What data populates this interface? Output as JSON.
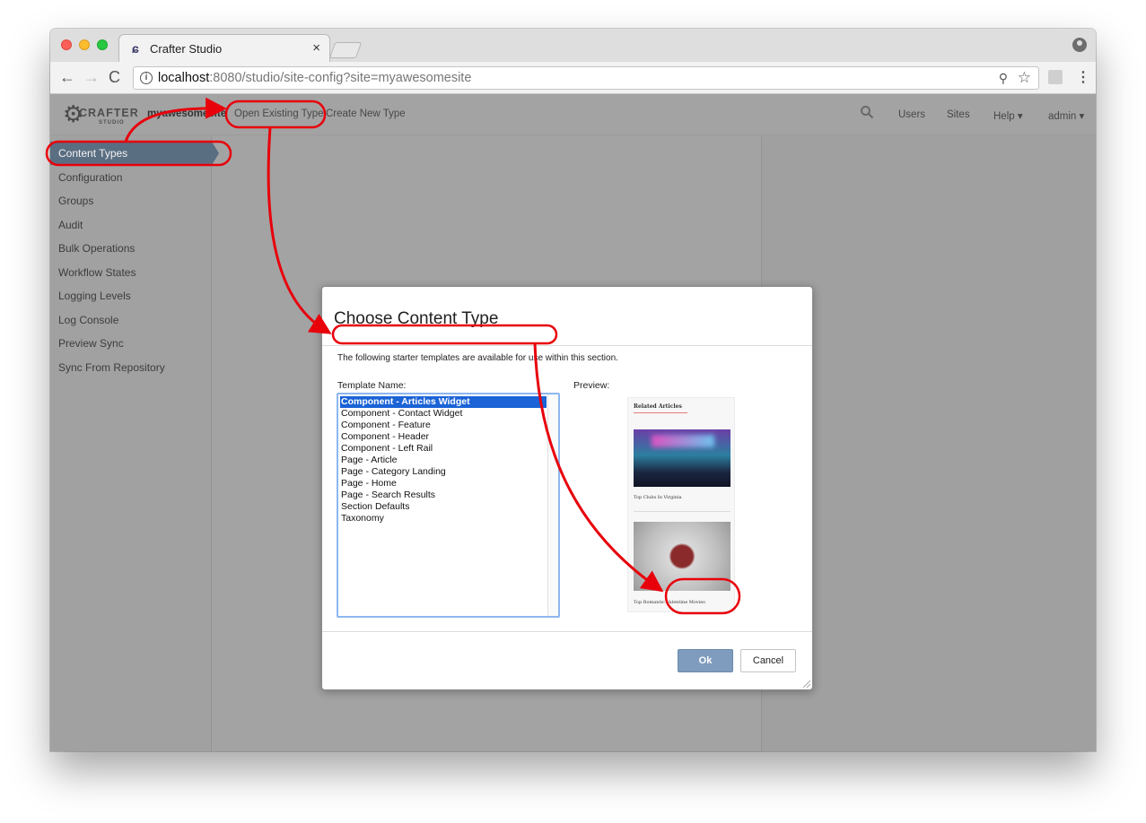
{
  "browser": {
    "tab_title": "Crafter Studio",
    "tab_close": "×",
    "url_host": "localhost",
    "url_rest": ":8080/studio/site-config?site=myawesomesite",
    "info_glyph": "i",
    "nav_back": "←",
    "nav_forward": "→",
    "nav_reload": "C",
    "zoom_glyph": "⚲",
    "star_glyph": "☆",
    "menu_glyph": "⋮"
  },
  "app": {
    "logo_text": "CRAFTER",
    "logo_sub": "STUDIO",
    "site_name": "myawesomesite",
    "nav": {
      "open_existing": "Open Existing Type",
      "create_new": "Create New Type"
    },
    "right_nav": {
      "users": "Users",
      "sites": "Sites",
      "help": "Help ▾",
      "admin": "admin ▾"
    }
  },
  "sidebar": {
    "active": "Content Types",
    "items": [
      "Configuration",
      "Groups",
      "Audit",
      "Bulk Operations",
      "Workflow States",
      "Logging Levels",
      "Log Console",
      "Preview Sync",
      "Sync From Repository"
    ]
  },
  "dialog": {
    "title": "Choose Content Type",
    "description": "The following starter templates are available for use within this section.",
    "template_label": "Template Name:",
    "preview_label": "Preview:",
    "templates": [
      "Component - Articles Widget",
      "Component - Contact Widget",
      "Component - Feature",
      "Component - Header",
      "Component - Left Rail",
      "Page - Article",
      "Page - Category Landing",
      "Page - Home",
      "Page - Search Results",
      "Section Defaults",
      "Taxonomy"
    ],
    "selected_template": "Component - Articles Widget",
    "preview": {
      "heading": "Related Articles",
      "caption_1": "Top Clubs In Virginia",
      "caption_2": "Top Romantic Valentine Movies"
    },
    "ok_label": "Ok",
    "cancel_label": "Cancel"
  },
  "colors": {
    "annotation": "#e8000b",
    "selection": "#1b63d6",
    "sidebar_active": "#5a6e82",
    "ok_button": "#7f9cbf"
  }
}
